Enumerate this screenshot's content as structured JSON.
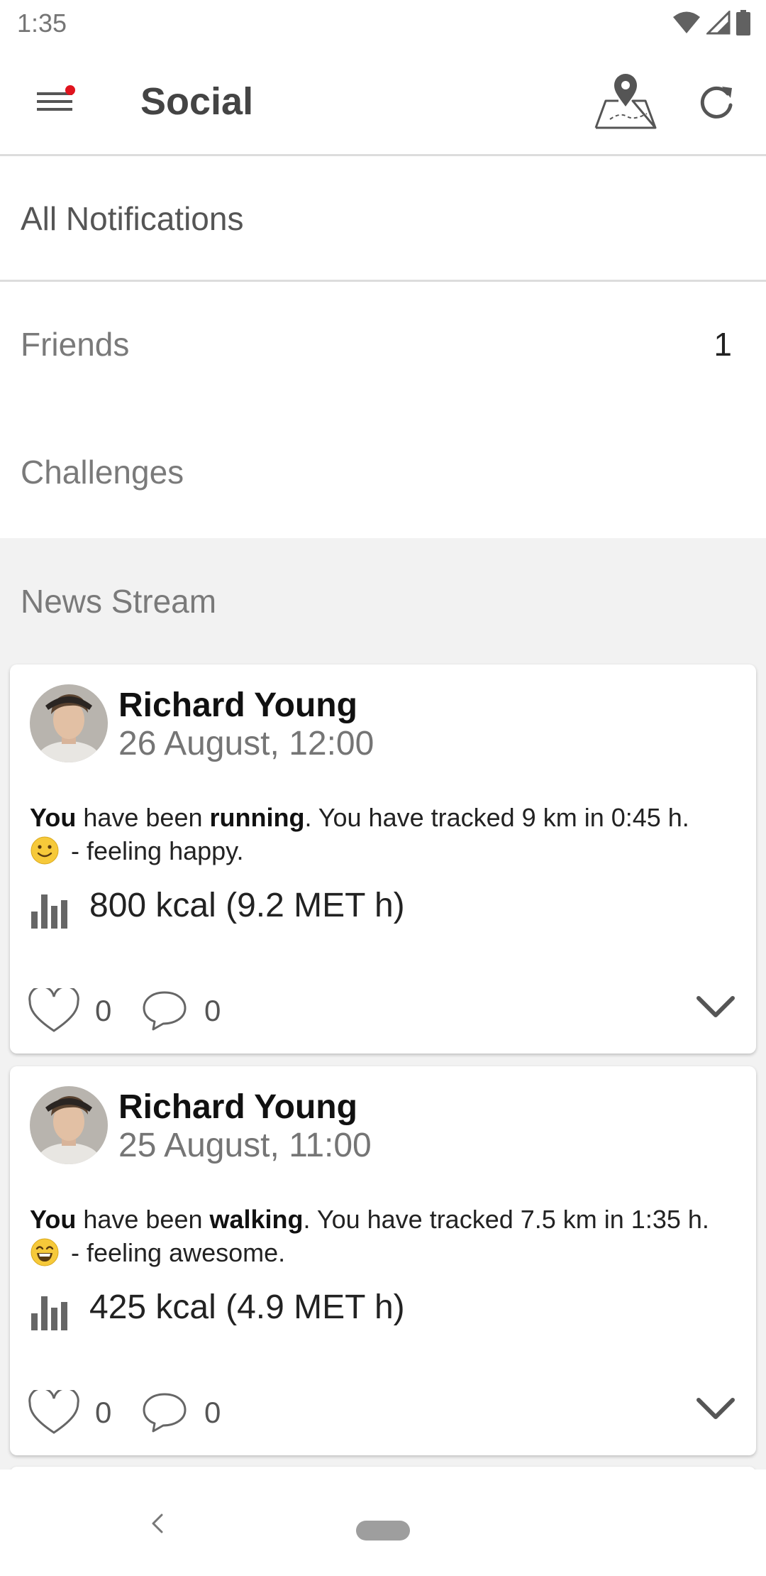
{
  "status_bar": {
    "time": "1:35",
    "icons": [
      "wifi-icon",
      "signal-icon",
      "battery-icon"
    ]
  },
  "app_bar": {
    "title": "Social",
    "menu_icon": "hamburger-menu-icon",
    "has_notification_dot": true,
    "actions": [
      "map-pin-icon",
      "refresh-icon"
    ]
  },
  "sections": {
    "all_notifications": "All Notifications",
    "friends": {
      "label": "Friends",
      "count": "1"
    },
    "challenges": "Challenges",
    "news_stream": "News Stream"
  },
  "posts": [
    {
      "author": "Richard Young",
      "date": "26 August, 12:00",
      "subject": "You",
      "text_1": " have been ",
      "activity": "running",
      "text_2": ". You have tracked 9 km in 0:45 h.",
      "mood_emoji": "🙂",
      "mood": " - feeling happy.",
      "stats": "800 kcal (9.2 MET h)",
      "likes": "0",
      "comments": "0"
    },
    {
      "author": "Richard Young",
      "date": "25 August, 11:00",
      "subject": "You",
      "text_1": " have been ",
      "activity": "walking",
      "text_2": ". You have tracked 7.5 km in 1:35 h.",
      "mood_emoji": "😄",
      "mood": " - feeling awesome.",
      "stats": "425 kcal (4.9 MET h)",
      "likes": "0",
      "comments": "0"
    }
  ],
  "colors": {
    "notification_dot": "#e0141e",
    "divider": "#dcdcdc",
    "news_background": "#f2f2f2"
  }
}
